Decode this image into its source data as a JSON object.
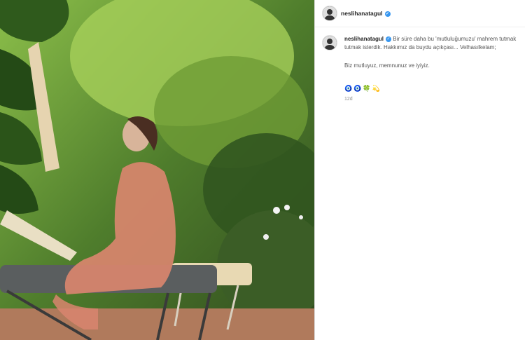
{
  "post": {
    "image_alt": "photo",
    "header_username": "neslihanatagul",
    "caption_username": "neslihanatagul",
    "caption_line1": "Bir süre daha bu 'mutluluğumuzu' mahrem tutmak tutmak isterdik. Hakkımız da buydu açıkçası... Velhasılkelam;",
    "caption_line2": "Biz mutluyuz, memnunuz ve iyiyiz.",
    "emojis": "🧿🧿🍀💫",
    "time": "12d"
  },
  "colors": {
    "verified": "#3897f0",
    "username": "#262626",
    "meta": "#8e8e8e"
  },
  "icons": [
    "verified-badge-icon"
  ]
}
